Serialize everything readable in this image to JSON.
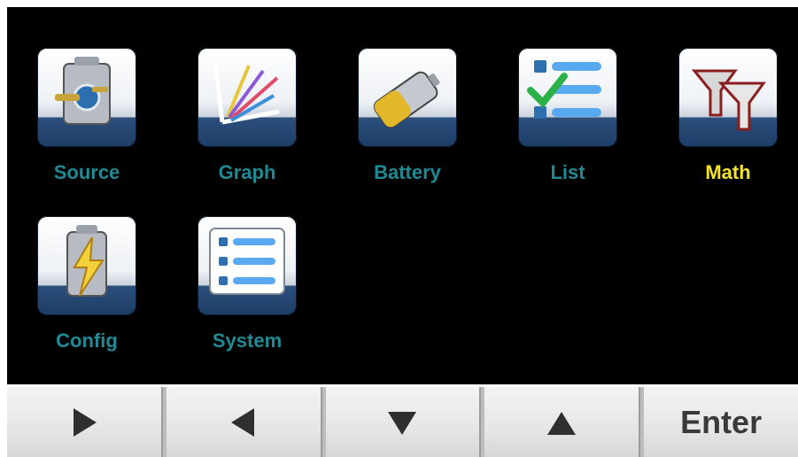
{
  "apps": [
    {
      "label": "Source",
      "icon": "source-battery-plug-icon",
      "active": false
    },
    {
      "label": "Graph",
      "icon": "graph-axes-icon",
      "active": false
    },
    {
      "label": "Battery",
      "icon": "battery-icon",
      "active": false
    },
    {
      "label": "List",
      "icon": "checklist-icon",
      "active": false
    },
    {
      "label": "Math",
      "icon": "funnels-icon",
      "active": true
    },
    {
      "label": "Config",
      "icon": "battery-lightning-icon",
      "active": false
    },
    {
      "label": "System",
      "icon": "system-list-icon",
      "active": false
    }
  ],
  "buttons": {
    "right_icon": "arrow-right-icon",
    "left_icon": "arrow-left-icon",
    "down_icon": "arrow-down-icon",
    "up_icon": "arrow-up-icon",
    "enter_label": "Enter"
  },
  "colors": {
    "label": "#1f8a93",
    "active_label": "#f2e32a",
    "screen": "#000000"
  }
}
